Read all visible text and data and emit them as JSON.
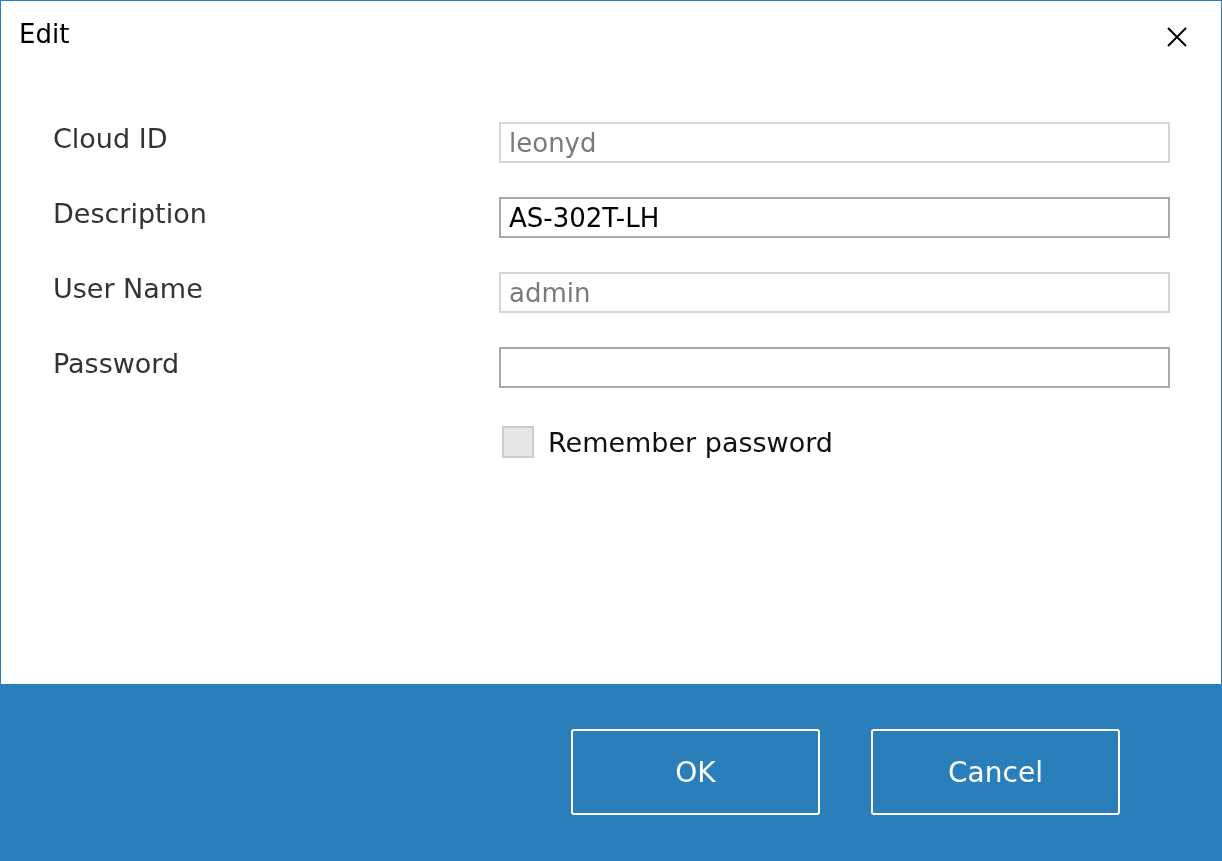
{
  "window": {
    "title": "Edit"
  },
  "fields": [
    {
      "label": "Cloud ID",
      "value": "leonyd",
      "disabled": true
    },
    {
      "label": "Description",
      "value": "AS-302T-LH",
      "disabled": false
    },
    {
      "label": "User Name",
      "value": "admin",
      "disabled": true
    },
    {
      "label": "Password",
      "disabled": false
    }
  ],
  "remember": {
    "label": "Remember password",
    "checked": false
  },
  "buttons": [
    "OK",
    "Cancel"
  ]
}
